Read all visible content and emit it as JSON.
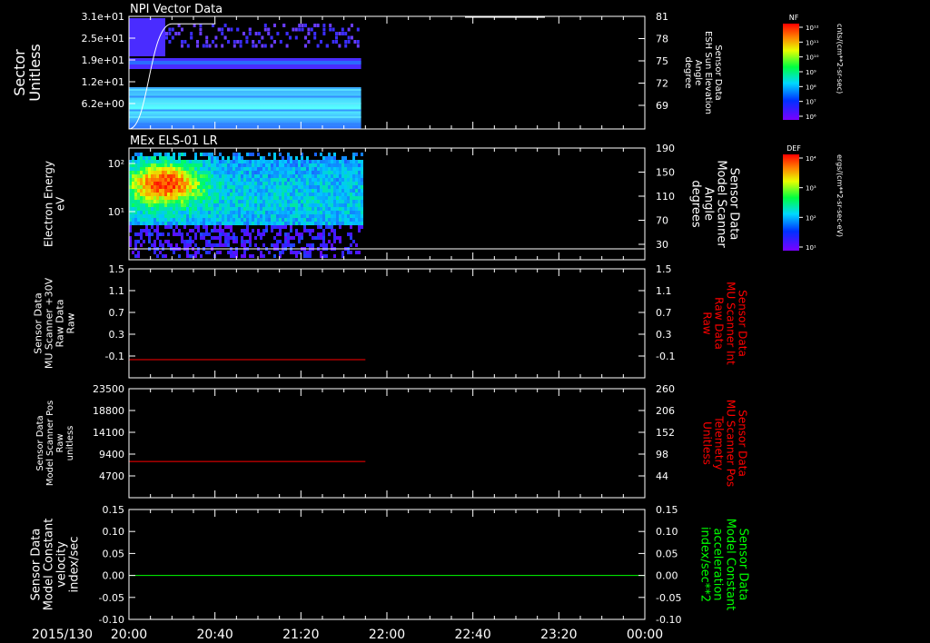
{
  "footer": {
    "date_label": "2015/130"
  },
  "time_ticks": [
    "20:00",
    "20:40",
    "21:20",
    "22:00",
    "22:40",
    "23:20",
    "00:00"
  ],
  "colorbars": [
    {
      "title": "NF",
      "unit_label": "cnts/(cm**2-sr-sec)",
      "ticks": [
        "10¹²",
        "10¹¹",
        "10¹⁰",
        "10⁹",
        "10⁸",
        "10⁷",
        "10⁶"
      ]
    },
    {
      "title": "DEF",
      "unit_label": "ergs/(cm**2-sr-sec-eV)",
      "ticks": [
        "10⁴",
        "10³",
        "10²",
        "10¹"
      ]
    }
  ],
  "colors": {
    "axis": "#ffffff",
    "red_trace": "#ff0000",
    "green_trace": "#00ff00",
    "spectrogram_low": "#3a1aff",
    "spectrogram_high": "#ff2200"
  },
  "chart_data": [
    {
      "type": "heatmap",
      "title": "NPI Vector Data",
      "ylabel": [
        "Sector",
        "Unitless"
      ],
      "yticks": [
        "3.1e+01",
        "2.5e+01",
        "1.9e+01",
        "1.2e+01",
        "6.2e+00"
      ],
      "right_ylabel": [
        "Sensor Data",
        "ESH Sun Elevation",
        "Angle",
        "degree"
      ],
      "right_yticks": [
        "81",
        "78",
        "75",
        "72",
        "69"
      ],
      "data_end_time": "21:48",
      "overlay_line": {
        "from": [
          "20:00",
          "67"
        ],
        "to": [
          "20:20",
          "81"
        ]
      }
    },
    {
      "type": "heatmap",
      "title": "MEx ELS-01 LR",
      "ylabel": [
        "Electron Energy",
        "eV"
      ],
      "yticks": [
        "10²",
        "10¹"
      ],
      "right_ylabel": [
        "Sensor Data",
        "Model Scanner",
        "Angle",
        "degrees"
      ],
      "right_yticks": [
        "190",
        "150",
        "110",
        "70",
        "30"
      ],
      "data_end_time": "21:48"
    },
    {
      "type": "line",
      "ylabel": [
        "Sensor Data",
        "MU Scanner +30V",
        "Raw Data",
        "Raw"
      ],
      "yticks": [
        "1.5",
        "1.1",
        "0.7",
        "0.3",
        "-0.1"
      ],
      "ylim": [
        -0.3,
        1.5
      ],
      "right_ylabel": [
        "Sensor Data",
        "MU Scanner Int",
        "Raw Data",
        "Raw"
      ],
      "right_yticks": [
        "1.5",
        "1.1",
        "0.7",
        "0.3",
        "-0.1"
      ],
      "series": [
        {
          "x": [
            "20:00",
            "21:50"
          ],
          "y": [
            0.0,
            0.0
          ]
        }
      ]
    },
    {
      "type": "line",
      "ylabel": [
        "Sensor Data",
        "Model Scanner Pos",
        "Raw",
        "unitless"
      ],
      "yticks": [
        "23500",
        "18800",
        "14100",
        "9400",
        "4700"
      ],
      "ylim": [
        0,
        23500
      ],
      "right_ylabel": [
        "Sensor Data",
        "MU Scanner Pos",
        "Telemetry",
        "Unitless"
      ],
      "right_yticks": [
        "260",
        "206",
        "152",
        "98",
        "44"
      ],
      "series": [
        {
          "x": [
            "20:00",
            "21:50"
          ],
          "y": [
            7800,
            7800
          ]
        }
      ]
    },
    {
      "type": "line",
      "ylabel": [
        "Sensor Data",
        "Model Constant",
        "velocity",
        "index/sec"
      ],
      "yticks": [
        "0.15",
        "0.10",
        "0.05",
        "0.00",
        "-0.05",
        "-0.10"
      ],
      "ylim": [
        -0.1,
        0.15
      ],
      "right_ylabel": [
        "Sensor Data",
        "Model Constant",
        "acceleration",
        "index/sec**2"
      ],
      "right_yticks": [
        "0.15",
        "0.10",
        "0.05",
        "0.00",
        "-0.05",
        "-0.10"
      ],
      "series": [
        {
          "x": [
            "20:00",
            "00:00"
          ],
          "y": [
            0.0,
            0.0
          ]
        }
      ]
    }
  ]
}
